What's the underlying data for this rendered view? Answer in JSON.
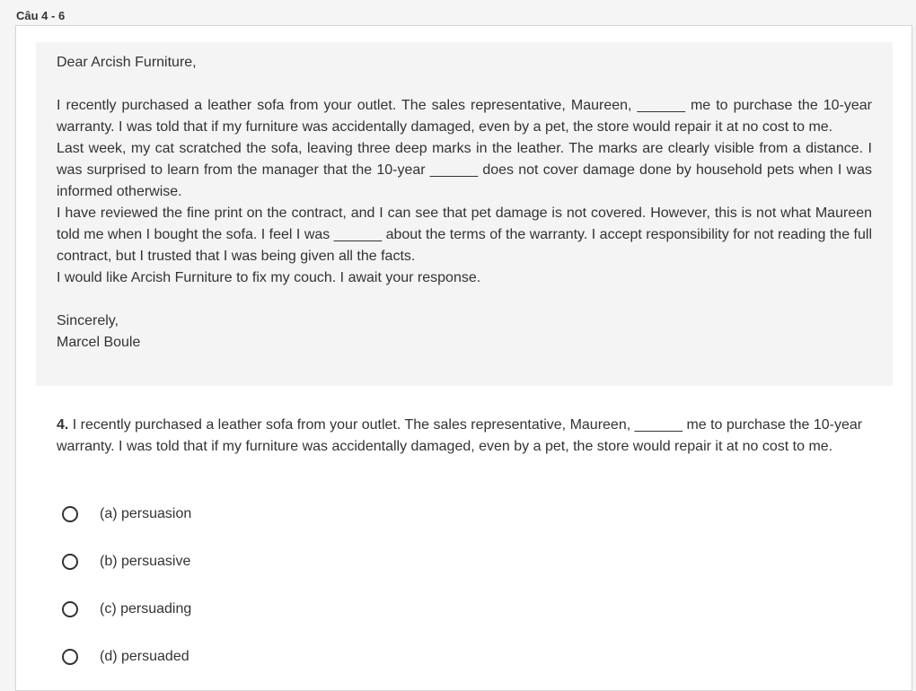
{
  "section": {
    "title": "Câu 4 - 6"
  },
  "passage": {
    "greeting": "Dear Arcish Furniture,",
    "paragraphs": [
      "I recently purchased a leather sofa from your outlet. The sales representative, Maureen, ______ me to purchase the 10-year warranty. I was told that if my furniture was accidentally damaged, even by a pet, the store would repair it at no cost to me.",
      "Last week, my cat scratched the sofa, leaving three deep marks in the leather. The marks are clearly visible from a distance. I was surprised to learn from the manager that the 10-year ______ does not cover damage done by household pets when I was informed otherwise.",
      "I have reviewed the fine print on the contract, and I can see that pet damage is not covered. However, this is not what Maureen told me when I bought the sofa. I feel I was ______ about the terms of the warranty. I accept responsibility for not reading the full contract, but I trusted that I was being given all the facts.",
      "I would like Arcish Furniture to fix my couch. I await your response."
    ],
    "closing": "Sincerely,",
    "signature": "Marcel Boule"
  },
  "question": {
    "number": "4.",
    "text": " I recently purchased a leather sofa from your outlet. The sales representative, Maureen, ______ me to purchase the 10-year warranty. I was told that if my furniture was accidentally damaged, even by a pet, the store would repair it at no cost to me.",
    "options": [
      {
        "label": "(a) persuasion"
      },
      {
        "label": "(b) persuasive"
      },
      {
        "label": "(c) persuading"
      },
      {
        "label": "(d) persuaded"
      }
    ]
  }
}
